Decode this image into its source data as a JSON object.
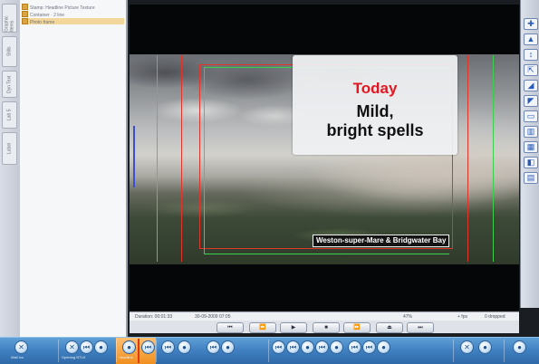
{
  "colors": {
    "accent_red": "#e11722",
    "caption_bg": "#f0f1f3",
    "dock_blue": "#3f7fc0",
    "dock_active": "#f08f1e",
    "guide_red": "#e0352b",
    "guide_green": "#3bd14d",
    "guide_blue": "#3a4ed8"
  },
  "layers": {
    "items": [
      {
        "label": "Stamp: Headline Picture Texture",
        "selected": false
      },
      {
        "label": "Container · 2 line",
        "selected": false
      },
      {
        "label": "Photo frame",
        "selected": true
      }
    ]
  },
  "left_strip": {
    "tabs": [
      "Graphic Items",
      "Stills",
      "Dyn Text",
      "Lab 5",
      "Label"
    ]
  },
  "caption": {
    "day": "Today",
    "description": "Mild,\nbright spells",
    "location": "Weston-super-Mare &  Bridgwater Bay"
  },
  "status": {
    "duration": "Duration: 00:01:33",
    "date": "30-09-2009 07:05",
    "zoom": "47%",
    "fps": "+ fps",
    "dropped": "0 dropped"
  },
  "transport": {
    "buttons": [
      {
        "name": "skip-start-button",
        "glyph": "⏮"
      },
      {
        "name": "rewind-button",
        "glyph": "⏪"
      },
      {
        "name": "play-button",
        "glyph": "▶"
      },
      {
        "name": "stop-button",
        "glyph": "■"
      },
      {
        "name": "fast-forward-button",
        "glyph": "⏩"
      },
      {
        "name": "eject-button",
        "glyph": "⏏"
      },
      {
        "name": "skip-end-button",
        "glyph": "⏭"
      }
    ]
  },
  "right_toolbar": {
    "glyphs": [
      "✚",
      "▲",
      "↕",
      "⇱",
      "◢",
      "◤",
      "▭",
      "▥",
      "▦",
      "◧",
      "▤"
    ]
  },
  "dock": {
    "items": [
      {
        "icon": "close-icon",
        "glyph": "✕",
        "label": "Wall Ivu"
      },
      {
        "icon": "close-icon",
        "glyph": "✕",
        "label": "Opening NTLK"
      },
      {
        "icon": "skip-icon",
        "glyph": "⏮",
        "label": ""
      },
      {
        "icon": "user-icon",
        "glyph": "●",
        "label": ""
      },
      {
        "icon": "user-icon",
        "glyph": "●",
        "label": "Headline"
      },
      {
        "icon": "skip-icon",
        "glyph": "⏮",
        "label": ""
      },
      {
        "icon": "skip-icon",
        "glyph": "⏮",
        "label": ""
      },
      {
        "icon": "user-icon",
        "glyph": "●",
        "label": ""
      },
      {
        "icon": "skip-icon",
        "glyph": "⏮",
        "label": ""
      },
      {
        "icon": "user-icon",
        "glyph": "●",
        "label": ""
      },
      {
        "icon": "skip-icon",
        "glyph": "⏮",
        "label": ""
      },
      {
        "icon": "skip-icon",
        "glyph": "⏮",
        "label": ""
      },
      {
        "icon": "user-icon",
        "glyph": "●",
        "label": ""
      },
      {
        "icon": "skip-icon",
        "glyph": "⏮",
        "label": ""
      },
      {
        "icon": "user-icon",
        "glyph": "●",
        "label": ""
      },
      {
        "icon": "skip-icon",
        "glyph": "⏮",
        "label": ""
      },
      {
        "icon": "skip-icon",
        "glyph": "⏮",
        "label": ""
      },
      {
        "icon": "user-icon",
        "glyph": "●",
        "label": ""
      },
      {
        "icon": "close-icon",
        "glyph": "✕",
        "label": ""
      },
      {
        "icon": "user-icon",
        "glyph": "●",
        "label": ""
      },
      {
        "icon": "user-icon",
        "glyph": "●",
        "label": ""
      }
    ]
  }
}
